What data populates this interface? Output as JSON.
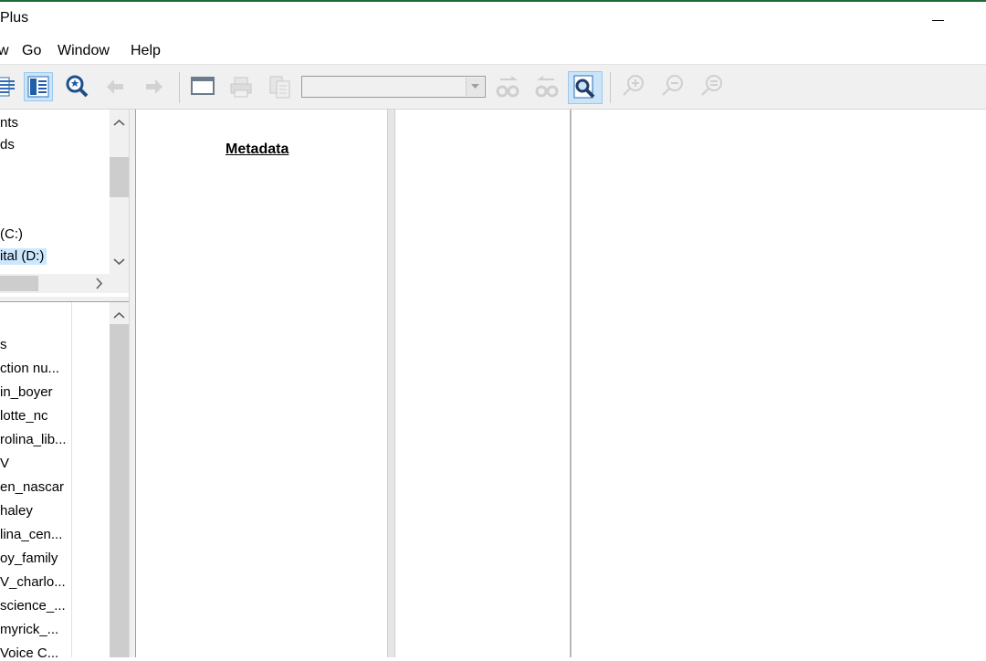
{
  "window": {
    "title": "Plus"
  },
  "menu": {
    "view": "w",
    "go": "Go",
    "window": "Window",
    "help": "Help"
  },
  "toolbar": {
    "buttons": [
      "bookmark-icon",
      "metadata-view-icon",
      "search-icon",
      "back-arrow-icon",
      "forward-arrow-icon",
      "window-icon",
      "print-icon",
      "copy-icon",
      "find-previous-icon",
      "find-next-icon",
      "find-icon",
      "zoom-in-icon",
      "zoom-out-icon",
      "zoom-reset-icon"
    ],
    "combo_value": ""
  },
  "tree": {
    "items": [
      "nts",
      "ds",
      " (C:)",
      "ital (D:)"
    ]
  },
  "list": {
    "items": [
      "s",
      "ction nu...",
      "in_boyer",
      "lotte_nc",
      "rolina_lib...",
      "V",
      "en_nascar",
      "haley",
      "lina_cen...",
      "oy_family",
      "V_charlo...",
      "science_...",
      "myrick_...",
      "Voice C..."
    ]
  },
  "metadata": {
    "title": "Metadata"
  }
}
